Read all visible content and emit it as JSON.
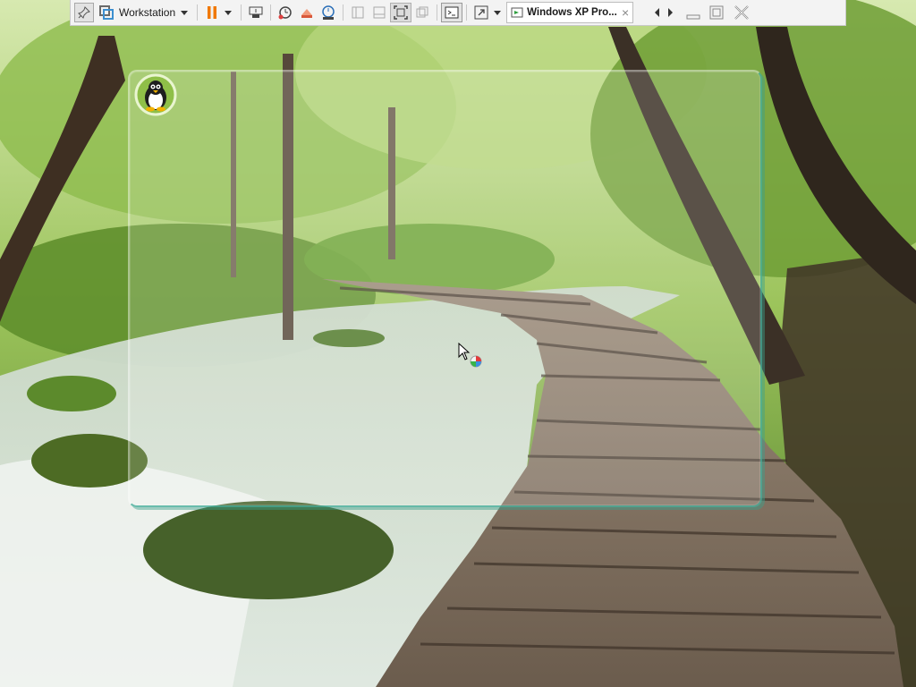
{
  "toolbar": {
    "product_label": "Workstation",
    "active_tab_title": "Windows XP Pro...",
    "tab_close_glyph": "×",
    "icons": [
      "pin-icon",
      "vmware-logo-icon",
      "pause-icon",
      "send-keys-icon",
      "snapshot-icon",
      "revert-snapshot-icon",
      "snapshot-manager-icon",
      "show-library-icon",
      "show-thumbnail-bar-icon",
      "fullscreen-icon",
      "unity-icon",
      "console-icon",
      "stretch-icon",
      "vm-tab-icon",
      "scroll-left-icon",
      "scroll-right-icon",
      "minimize-icon",
      "restore-icon",
      "close-icon"
    ],
    "accent_color": "#f07800"
  },
  "desktop": {
    "wallpaper": "forest boardwalk over stream",
    "overlay_window_border_color": "#3aa896"
  }
}
